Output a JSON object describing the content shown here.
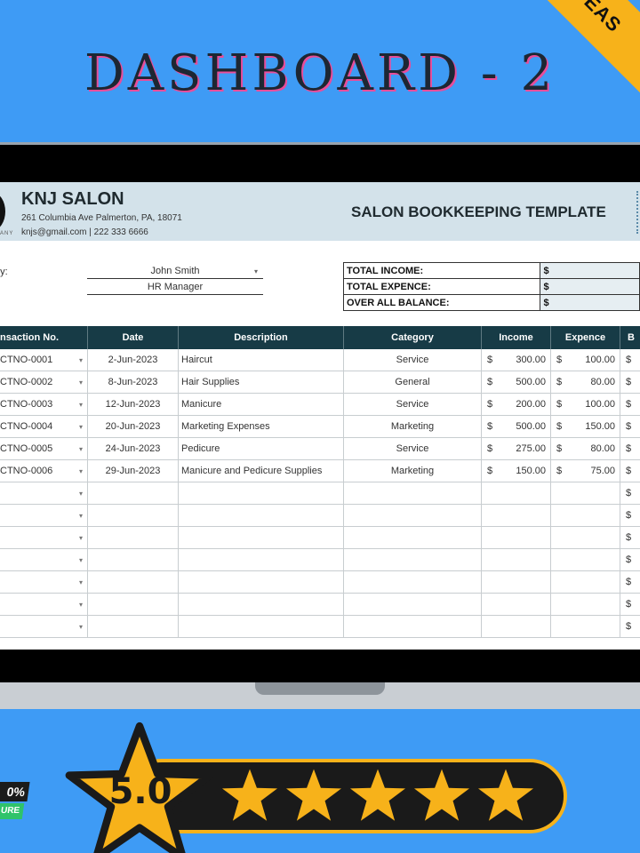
{
  "ribbon": {
    "text": "EAS"
  },
  "headline": "DASHBOARD - 2",
  "sheet": {
    "company": "KNJ SALON",
    "logo_sub": "ANY",
    "address": "261 Columbia Ave Palmerton, PA, 18071",
    "contact": "knjs@gmail.com | 222 333 6666",
    "title": "SALON BOOKKEEPING TEMPLATE",
    "prepared_by_label": "oy:",
    "prepared_by_name": "John Smith",
    "prepared_by_role": "HR Manager",
    "summary": [
      {
        "label": "TOTAL INCOME:",
        "currency": "$"
      },
      {
        "label": "TOTAL EXPENCE:",
        "currency": "$"
      },
      {
        "label": "OVER ALL BALANCE:",
        "currency": "$"
      }
    ],
    "columns": [
      "nsaction No.",
      "Date",
      "Description",
      "Category",
      "Income",
      "Expence",
      "B"
    ],
    "rows": [
      {
        "tx": "CTNO-0001",
        "date": "2-Jun-2023",
        "desc": "Haircut",
        "cat": "Service",
        "inc": "300.00",
        "exp": "100.00"
      },
      {
        "tx": "CTNO-0002",
        "date": "8-Jun-2023",
        "desc": "Hair Supplies",
        "cat": "General",
        "inc": "500.00",
        "exp": "80.00"
      },
      {
        "tx": "CTNO-0003",
        "date": "12-Jun-2023",
        "desc": "Manicure",
        "cat": "Service",
        "inc": "200.00",
        "exp": "100.00"
      },
      {
        "tx": "CTNO-0004",
        "date": "20-Jun-2023",
        "desc": "Marketing Expenses",
        "cat": "Marketing",
        "inc": "500.00",
        "exp": "150.00"
      },
      {
        "tx": "CTNO-0005",
        "date": "24-Jun-2023",
        "desc": "Pedicure",
        "cat": "Service",
        "inc": "275.00",
        "exp": "80.00"
      },
      {
        "tx": "CTNO-0006",
        "date": "29-Jun-2023",
        "desc": "Manicure and Pedicure Supplies",
        "cat": "Marketing",
        "inc": "150.00",
        "exp": "75.00"
      }
    ],
    "currency": "$",
    "dropdown_glyph": "▾"
  },
  "badge": {
    "top": "0%",
    "bottom": "URE"
  },
  "rating": {
    "score": "5.0",
    "stars": 5,
    "star_color": "#f7b21a"
  },
  "colors": {
    "background": "#3e9bf5",
    "header_fill": "#173b46",
    "accent": "#f7b21a"
  }
}
